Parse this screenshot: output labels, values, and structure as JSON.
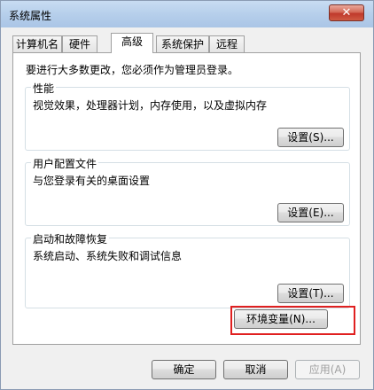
{
  "window": {
    "title": "系统属性",
    "close_glyph": "✕"
  },
  "tabs": [
    {
      "label": "计算机名",
      "active": false
    },
    {
      "label": "硬件",
      "active": false
    },
    {
      "label": "高级",
      "active": true
    },
    {
      "label": "系统保护",
      "active": false
    },
    {
      "label": "远程",
      "active": false
    }
  ],
  "advanced": {
    "admin_note": "要进行大多数更改，您必须作为管理员登录。",
    "performance": {
      "title": "性能",
      "description": "视觉效果，处理器计划，内存使用，以及虚拟内存",
      "button": "设置(S)..."
    },
    "user_profiles": {
      "title": "用户配置文件",
      "description": "与您登录有关的桌面设置",
      "button": "设置(E)..."
    },
    "startup_recovery": {
      "title": "启动和故障恢复",
      "description": "系统启动、系统失败和调试信息",
      "button": "设置(T)..."
    },
    "env_button": "环境变量(N)..."
  },
  "footer": {
    "ok": "确定",
    "cancel": "取消",
    "apply": "应用(A)"
  },
  "colors": {
    "highlight_border": "#e02020"
  }
}
